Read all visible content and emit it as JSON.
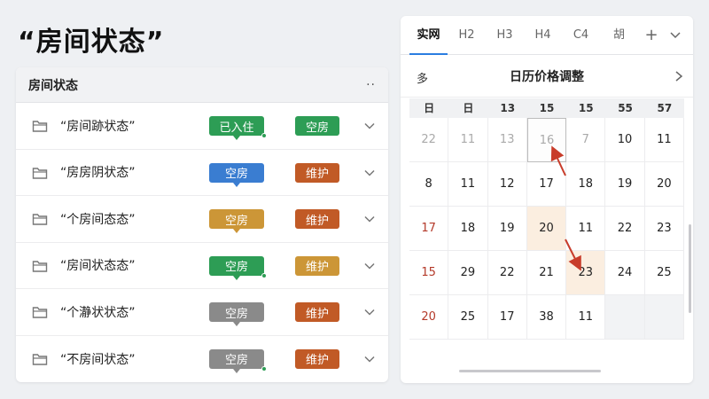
{
  "page_title": "“房间状态”",
  "left": {
    "header_title": "房间状态",
    "more": "··",
    "rows": [
      {
        "name": "“房间跡状态”",
        "b1": "已入住",
        "b1_color": "#2d9d55",
        "b1_dot": true,
        "b2": "空房",
        "b2_color": "#2d9d55"
      },
      {
        "name": "“房房阴状态”",
        "b1": "空房",
        "b1_color": "#3a7dd1",
        "b1_dot": false,
        "b2": "维护",
        "b2_color": "#c15a26"
      },
      {
        "name": "“个房间态态”",
        "b1": "空房",
        "b1_color": "#cc9637",
        "b1_dot": false,
        "b2": "维护",
        "b2_color": "#c15a26"
      },
      {
        "name": "“房间状态态”",
        "b1": "空房",
        "b1_color": "#2d9d55",
        "b1_dot": true,
        "b2": "维护",
        "b2_color": "#cc9637"
      },
      {
        "name": "“个瀞状状态”",
        "b1": "空房",
        "b1_color": "#8a8a8a",
        "b1_dot": false,
        "b2": "维护",
        "b2_color": "#c15a26"
      },
      {
        "name": "“不房间状态”",
        "b1": "空房",
        "b1_color": "#8a8a8a",
        "b1_dot": true,
        "b2": "维护",
        "b2_color": "#c15a26"
      }
    ]
  },
  "right": {
    "tabs": [
      "实网",
      "H2",
      "H3",
      "H4",
      "C4",
      "胡"
    ],
    "tab_add": "+",
    "cal_left": "多",
    "cal_title": "日历价格调整",
    "weekdays": [
      "日",
      "日",
      "13",
      "15",
      "15",
      "55",
      "57"
    ],
    "weeks": [
      [
        {
          "t": "22",
          "s": "grey"
        },
        {
          "t": "11",
          "s": "grey"
        },
        {
          "t": "13",
          "s": "grey"
        },
        {
          "t": "16",
          "s": "grey sel"
        },
        {
          "t": "7",
          "s": "grey"
        },
        {
          "t": "10",
          "s": ""
        },
        {
          "t": "11",
          "s": ""
        }
      ],
      [
        {
          "t": "8",
          "s": ""
        },
        {
          "t": "11",
          "s": ""
        },
        {
          "t": "12",
          "s": ""
        },
        {
          "t": "17",
          "s": ""
        },
        {
          "t": "18",
          "s": ""
        },
        {
          "t": "19",
          "s": ""
        },
        {
          "t": "20",
          "s": ""
        }
      ],
      [
        {
          "t": "17",
          "s": "red"
        },
        {
          "t": "18",
          "s": ""
        },
        {
          "t": "19",
          "s": ""
        },
        {
          "t": "20",
          "s": "hl"
        },
        {
          "t": "11",
          "s": ""
        },
        {
          "t": "22",
          "s": ""
        },
        {
          "t": "23",
          "s": ""
        }
      ],
      [
        {
          "t": "15",
          "s": "red"
        },
        {
          "t": "29",
          "s": ""
        },
        {
          "t": "22",
          "s": ""
        },
        {
          "t": "21",
          "s": ""
        },
        {
          "t": "23",
          "s": "hl"
        },
        {
          "t": "24",
          "s": ""
        },
        {
          "t": "25",
          "s": ""
        }
      ],
      [
        {
          "t": "20",
          "s": "red"
        },
        {
          "t": "25",
          "s": ""
        },
        {
          "t": "17",
          "s": ""
        },
        {
          "t": "38",
          "s": ""
        },
        {
          "t": "11",
          "s": ""
        },
        {
          "t": "",
          "s": "disabled"
        },
        {
          "t": "",
          "s": "disabled"
        }
      ]
    ]
  }
}
